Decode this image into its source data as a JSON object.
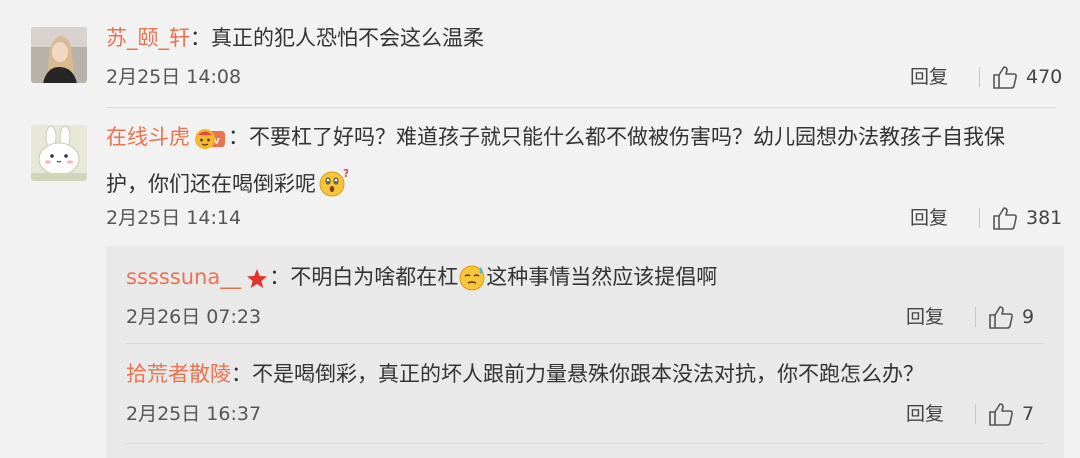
{
  "comments": [
    {
      "user": "苏_颐_轩",
      "text": "真正的犯人恐怕不会这么温柔",
      "time": "2月25日 14:08",
      "reply": "回复",
      "likes": "470"
    },
    {
      "user": "在线斗虎",
      "text_line1": "不要杠了好吗？难道孩子就只能什么都不做被伤害吗？幼儿园想办法教孩子自我保",
      "text_line2": "护，你们还在喝倒彩呢",
      "time": "2月25日 14:14",
      "reply": "回复",
      "likes": "381"
    }
  ],
  "replies": [
    {
      "user": "sssssuna__",
      "text_a": "不明白为啥都在杠",
      "text_b": "这种事情当然应该提倡啊",
      "time": "2月26日 07:23",
      "reply": "回复",
      "likes": "9"
    },
    {
      "user": "拾荒者散陵",
      "text": "不是喝倒彩，真正的坏人跟前力量悬殊你跟本没法对抗，你不跑怎么办？",
      "time": "2月25日 16:37",
      "reply": "回复",
      "likes": "7"
    }
  ],
  "colon": "：",
  "colors": {
    "username": "#eb7350",
    "background": "#f2f2f2",
    "reply_box": "#e9e9e9"
  }
}
